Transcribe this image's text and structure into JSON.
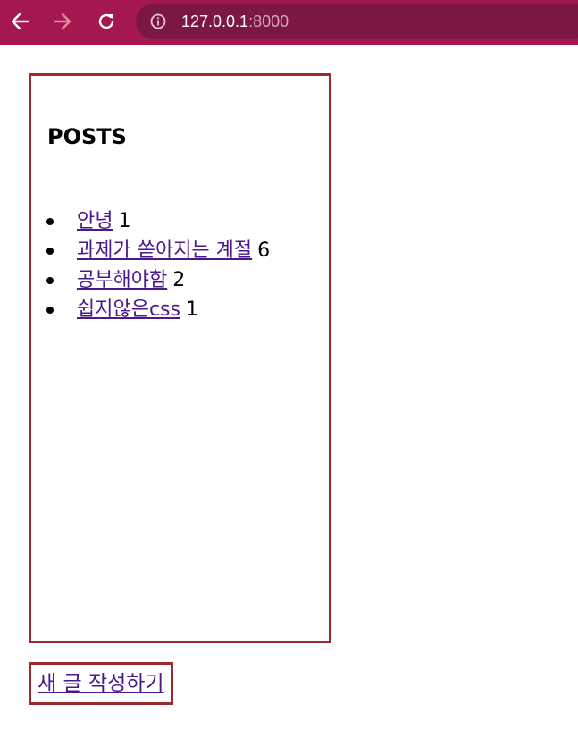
{
  "browser": {
    "url_host": "127.0.0.1",
    "url_port": ":8000",
    "back_icon": "arrow-left-icon",
    "forward_icon": "arrow-right-icon",
    "reload_icon": "reload-icon",
    "info_icon": "info-icon",
    "bar_color": "#a5184f"
  },
  "posts": {
    "title": "POSTS",
    "items": [
      {
        "label": "안녕",
        "count": "1"
      },
      {
        "label": "과제가 쏟아지는 계절",
        "count": "6"
      },
      {
        "label": "공부해야함",
        "count": "2"
      },
      {
        "label": "쉽지않은css",
        "count": "1"
      }
    ],
    "border_color": "#9c2b2e"
  },
  "new_post": {
    "label": "새 글 작성하기"
  }
}
